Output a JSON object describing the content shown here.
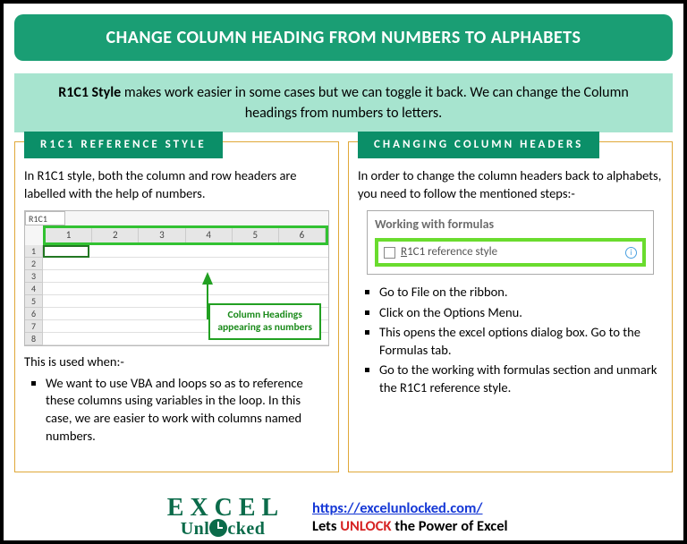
{
  "title": "CHANGE COLUMN HEADING FROM NUMBERS TO ALPHABETS",
  "subtitle_bold": "R1C1 Style",
  "subtitle_rest": " makes work easier in some cases but we can toggle it back. We can change the Column headings from numbers to letters.",
  "left": {
    "header": "R1C1 REFERENCE STYLE",
    "intro": "In R1C1 style, both the column and row headers are labelled with the help of numbers.",
    "namebox": "R1C1",
    "col_heads": [
      "1",
      "2",
      "3",
      "4",
      "5",
      "6"
    ],
    "row_nums": [
      "1",
      "2",
      "3",
      "4",
      "5",
      "6",
      "7",
      "8"
    ],
    "callout_l1": "Column Headings",
    "callout_l2": "appearing as numbers",
    "used_when": "This is used when:-",
    "bullet": "We want to use VBA and loops so as to reference these columns using variables in the loop. In this case, we are easier to work with columns named numbers."
  },
  "right": {
    "header": "CHANGING COLUMN HEADERS",
    "intro": "In order to change the column headers back to alphabets, you need to follow the mentioned steps:-",
    "box_title": "Working with formulas",
    "check_pre": "R",
    "check_rest": "1C1 reference style",
    "steps": [
      "Go to File on the ribbon.",
      "Click on the Options Menu.",
      "This opens the excel options dialog box. Go to the Formulas tab.",
      "Go to the working with formulas section and unmark the R1C1 reference style."
    ]
  },
  "footer": {
    "logo_l1": "E X C E L",
    "logo_l2a": "Unl",
    "logo_l2b": "cked",
    "url": "https://excelunlocked.com/",
    "tag_a": "Lets ",
    "tag_unlock": "UNLOCK",
    "tag_b": " the Power of Excel"
  }
}
